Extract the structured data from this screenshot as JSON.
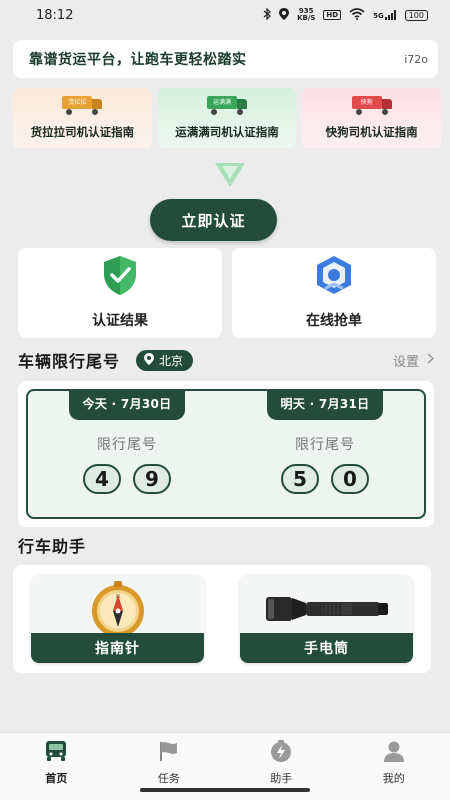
{
  "status_bar": {
    "time": "18:12",
    "network_speed_top": "935",
    "network_speed_bottom": "KB/S",
    "hd": "HD",
    "signal_type": "5G",
    "battery": "100"
  },
  "slogan": {
    "text": "靠谱货运平台，让跑车更轻松踏实",
    "count": "i72o"
  },
  "guides": [
    {
      "label": "货拉拉司机认证指南",
      "truck_tag": "货拉拉",
      "color": "#e8a234"
    },
    {
      "label": "运满满司机认证指南",
      "truck_tag": "运满满",
      "color": "#3ba55c"
    },
    {
      "label": "快狗司机认证指南",
      "truck_tag": "快狗",
      "color": "#e04a4a"
    }
  ],
  "certify_button": "立即认证",
  "features": [
    {
      "label": "认证结果",
      "icon": "shield-check-icon"
    },
    {
      "label": "在线抢单",
      "icon": "badge-icon"
    }
  ],
  "plate_section": {
    "title": "车辆限行尾号",
    "city": "北京",
    "settings": "设置"
  },
  "plate_days": [
    {
      "date": "今天 · 7月30日",
      "label": "限行尾号",
      "digits": [
        "4",
        "9"
      ]
    },
    {
      "date": "明天 · 7月31日",
      "label": "限行尾号",
      "digits": [
        "5",
        "0"
      ]
    }
  ],
  "assistant": {
    "title": "行车助手",
    "tools": [
      {
        "label": "指南针",
        "icon": "compass-icon"
      },
      {
        "label": "手电筒",
        "icon": "flashlight-icon"
      }
    ]
  },
  "tabs": [
    {
      "label": "首页",
      "icon": "truck-icon",
      "active": true
    },
    {
      "label": "任务",
      "icon": "flag-icon",
      "active": false
    },
    {
      "label": "助手",
      "icon": "lightning-icon",
      "active": false
    },
    {
      "label": "我的",
      "icon": "person-icon",
      "active": false
    }
  ],
  "colors": {
    "primary": "#234d3a",
    "background": "#ececec"
  }
}
